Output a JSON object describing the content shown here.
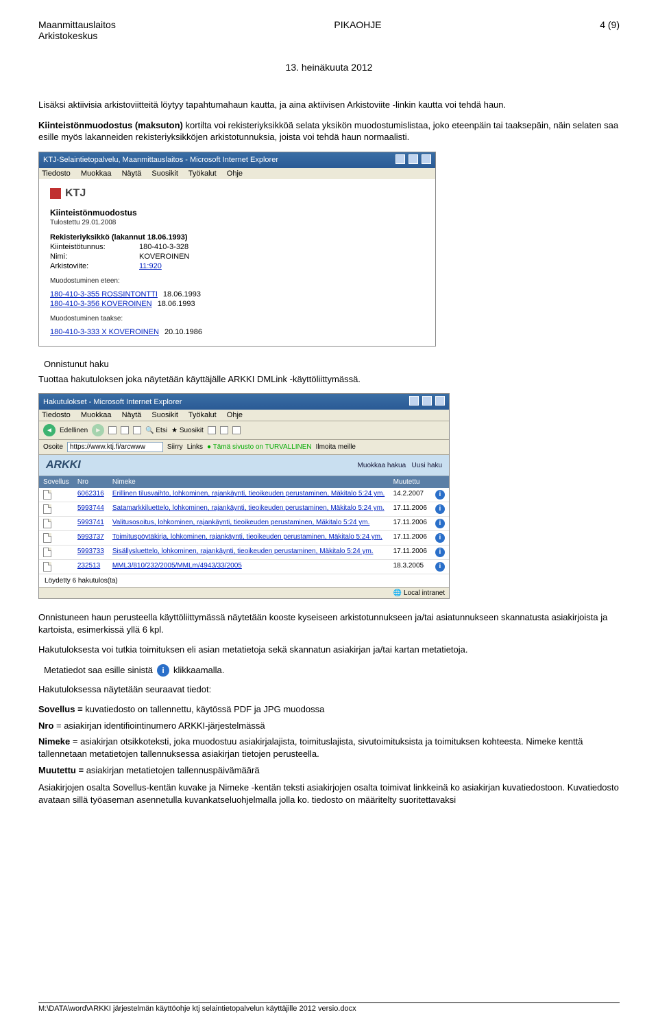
{
  "header": {
    "org": "Maanmittauslaitos",
    "dept": "Arkistokeskus",
    "doc_type": "PIKAOHJE",
    "page": "4 (9)",
    "date": "13. heinäkuuta 2012"
  },
  "intro": {
    "p1": "Lisäksi aktiivisia arkistoviitteitä löytyy tapahtumahaun kautta, ja aina aktiivisen Arkistoviite -linkin kautta voi tehdä haun.",
    "p2_bold": "Kiinteistönmuodostus (maksuton)",
    "p2_rest": " kortilta voi rekisteriyksikköä selata yksikön muodostumislistaa, joko eteenpäin tai taaksepäin, näin selaten saa esille myös lakanneiden rekisteriyksikköjen arkistotunnuksia, joista voi tehdä haun normaalisti."
  },
  "shot1": {
    "title": "KTJ-Selaintietopalvelu, Maanmittauslaitos - Microsoft Internet Explorer",
    "menu": [
      "Tiedosto",
      "Muokkaa",
      "Näytä",
      "Suosikit",
      "Työkalut",
      "Ohje"
    ],
    "logo": "KTJ",
    "heading": "Kiinteistönmuodostus",
    "printed": "Tulostettu 29.01.2008",
    "sec_head": "Rekisteriyksikkö (lakannut 18.06.1993)",
    "rows": {
      "kt_label": "Kiinteistötunnus:",
      "kt_value": "180-410-3-328",
      "nimi_label": "Nimi:",
      "nimi_value": "KOVEROINEN",
      "av_label": "Arkistoviite:",
      "av_value": "11:920"
    },
    "eteen_head": "Muodostuminen eteen:",
    "eteen_items": [
      {
        "link": "180-410-3-355  ROSSINTONTTI",
        "date": "18.06.1993"
      },
      {
        "link": "180-410-3-356  KOVEROINEN",
        "date": "18.06.1993"
      }
    ],
    "taakse_head": "Muodostuminen taakse:",
    "taakse_items": [
      {
        "link": "180-410-3-333 X  KOVEROINEN",
        "date": "20.10.1986"
      }
    ]
  },
  "onnistunut": {
    "title": "Onnistunut haku",
    "p": "Tuottaa hakutuloksen joka näytetään käyttäjälle ARKKI DMLink -käyttöliittymässä."
  },
  "shot2": {
    "title": "Hakutulokset - Microsoft Internet Explorer",
    "menu": [
      "Tiedosto",
      "Muokkaa",
      "Näytä",
      "Suosikit",
      "Työkalut",
      "Ohje"
    ],
    "tb": {
      "back": "Edellinen",
      "etsi": "Etsi",
      "suosikit": "Suosikit"
    },
    "addr_label": "Osoite",
    "addr_value": "https://www.ktj.fi/arcwww",
    "siirry": "Siirry",
    "links_label": "Links",
    "sec_msg": "Tämä sivusto on TURVALLINEN",
    "ilmoita": "Ilmoita meille",
    "arkki": "ARKKI",
    "mod_search": "Muokkaa hakua",
    "new_search": "Uusi haku",
    "cols": {
      "c1": "Sovellus",
      "c2": "Nro",
      "c3": "Nimeke",
      "c4": "Muutettu"
    },
    "rows": [
      {
        "nro": "6062316",
        "nimeke": "Erillinen tilusvaihto, lohkominen, rajankäynti, tieoikeuden perustaminen, Mäkitalo 5:24 ym.",
        "date": "14.2.2007"
      },
      {
        "nro": "5993744",
        "nimeke": "Satamarkkiluettelo, lohkominen, rajankäynti, tieoikeuden perustaminen, Mäkitalo 5:24 ym.",
        "date": "17.11.2006"
      },
      {
        "nro": "5993741",
        "nimeke": "Valitusosoitus, lohkominen, rajankäynti, tieoikeuden perustaminen, Mäkitalo 5:24 ym.",
        "date": "17.11.2006"
      },
      {
        "nro": "5993737",
        "nimeke": "Toimituspöytäkirja, lohkominen, rajankäynti, tieoikeuden perustaminen, Mäkitalo 5:24 ym.",
        "date": "17.11.2006"
      },
      {
        "nro": "5993733",
        "nimeke": "Sisällysluettelo, lohkominen, rajankäynti, tieoikeuden perustaminen, Mäkitalo 5:24 ym.",
        "date": "17.11.2006"
      },
      {
        "nro": "232513",
        "nimeke": "MML3/810/232/2005/MMLm/4943/33/2005",
        "date": "18.3.2005"
      }
    ],
    "found": "Löydetty 6 hakutulos(ta)",
    "status": "Local intranet"
  },
  "after": {
    "p1": "Onnistuneen haun perusteella käyttöliittymässä näytetään kooste kyseiseen arkistotunnukseen ja/tai asiatunnukseen skannatusta asiakirjoista ja kartoista, esimerkissä yllä  6 kpl.",
    "p2": "Hakutuloksesta voi tutkia toimituksen eli asian metatietoja sekä skannatun asiakirjan ja/tai kartan metatietoja.",
    "meta_left": "Metatiedot saa esille sinistä",
    "meta_right": "klikkaamalla.",
    "p3": "Hakutuloksessa näytetään seuraavat tiedot:",
    "defs": [
      {
        "term": "Sovellus =",
        "body": "  kuvatiedosto on tallennettu, käytössä PDF ja JPG muodossa"
      },
      {
        "term": "Nro",
        "body": " = asiakirjan identifiointinumero ARKKI-järjestelmässä"
      },
      {
        "term": "Nimeke",
        "body": " = asiakirjan otsikkoteksti, joka muodostuu asiakirjalajista, toimituslajista, sivutoimituksista ja toimituksen kohteesta. Nimeke kenttä tallennetaan metatietojen tallennuksessa asiakirjan tietojen perusteella."
      },
      {
        "term": "Muutettu =",
        "body": "  asiakirjan metatietojen tallennuspäivämäärä"
      }
    ],
    "p4": "Asiakirjojen osalta Sovellus-kentän kuvake ja Nimeke -kentän teksti asiakirjojen osalta toimivat linkkeinä ko asiakirjan kuvatiedostoon. Kuvatiedosto avataan sillä työaseman asennetulla kuvankatseluohjelmalla jolla ko. tiedosto on määritelty suoritettavaksi"
  },
  "footer": "M:\\DATA\\word\\ARKKI järjestelmän käyttöohje ktj selaintietopalvelun käyttäjille 2012 versio.docx"
}
